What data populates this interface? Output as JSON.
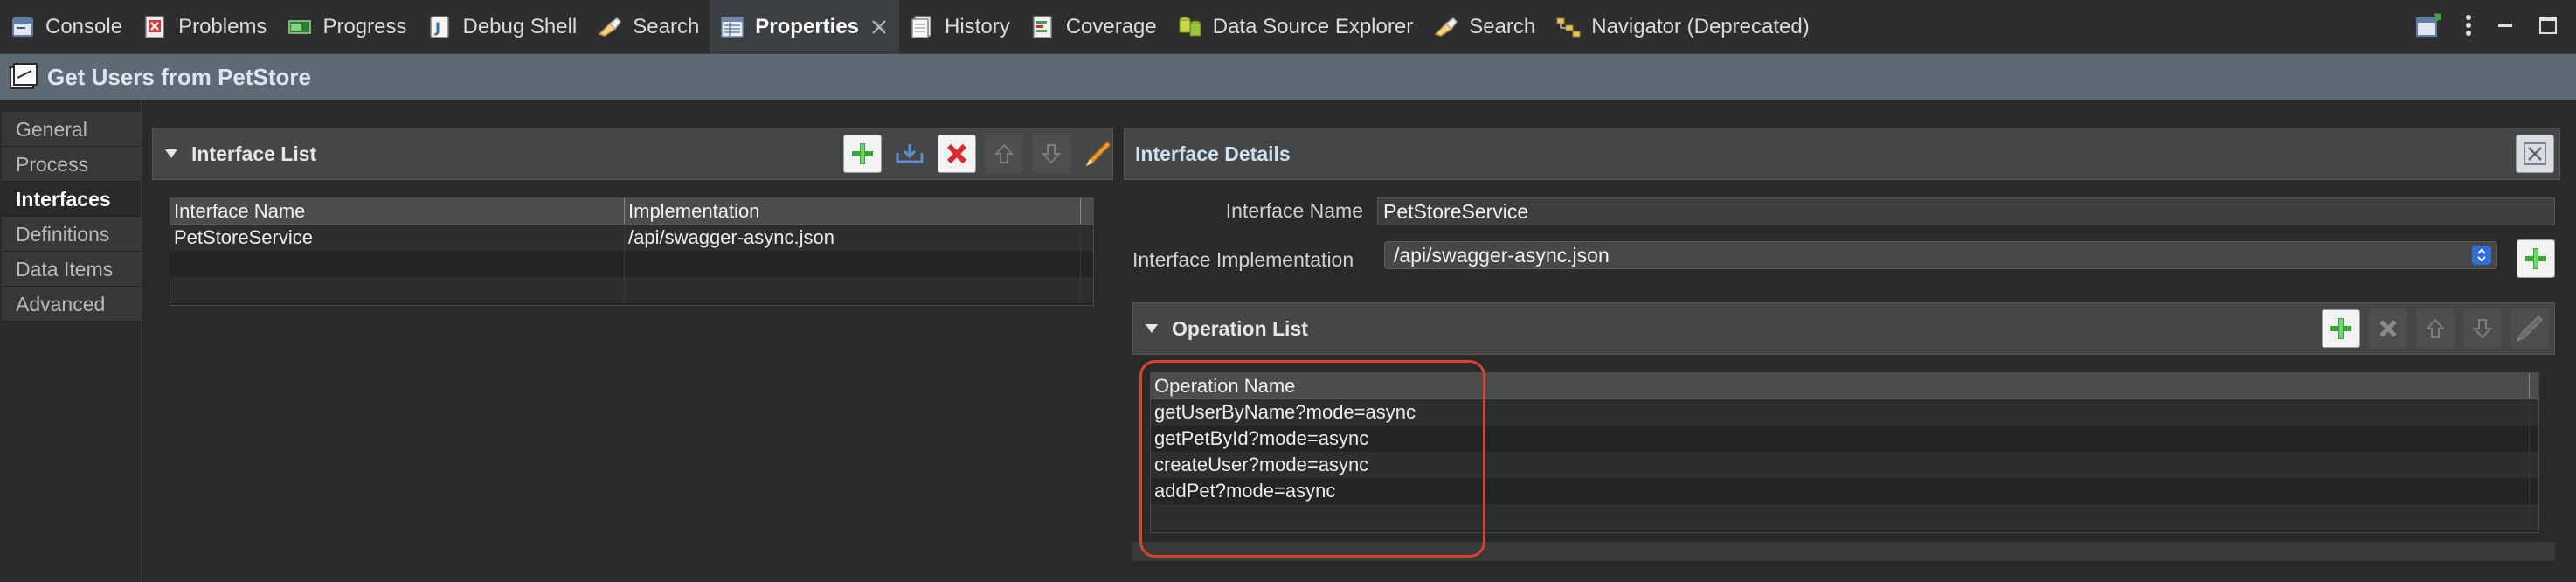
{
  "tabs": [
    {
      "label": "Console",
      "icon": "console-icon"
    },
    {
      "label": "Problems",
      "icon": "problems-icon"
    },
    {
      "label": "Progress",
      "icon": "progress-icon"
    },
    {
      "label": "Debug Shell",
      "icon": "debug-shell-icon"
    },
    {
      "label": "Search",
      "icon": "search-icon"
    },
    {
      "label": "Properties",
      "icon": "properties-icon",
      "active": true
    },
    {
      "label": "History",
      "icon": "history-icon"
    },
    {
      "label": "Coverage",
      "icon": "coverage-icon"
    },
    {
      "label": "Data Source Explorer",
      "icon": "data-source-explorer-icon"
    },
    {
      "label": "Search",
      "icon": "search-icon"
    },
    {
      "label": "Navigator (Deprecated)",
      "icon": "navigator-icon"
    }
  ],
  "editor": {
    "title": "Get Users from PetStore"
  },
  "nav": {
    "items": [
      {
        "label": "General"
      },
      {
        "label": "Process"
      },
      {
        "label": "Interfaces",
        "active": true
      },
      {
        "label": "Definitions"
      },
      {
        "label": "Data Items"
      },
      {
        "label": "Advanced"
      }
    ]
  },
  "interface_list": {
    "title": "Interface List",
    "columns": [
      "Interface Name",
      "Implementation"
    ],
    "rows": [
      [
        "PetStoreService",
        "/api/swagger-async.json"
      ]
    ]
  },
  "interface_details": {
    "title": "Interface Details",
    "name_label": "Interface Name",
    "name_value": "PetStoreService",
    "impl_label": "Interface Implementation",
    "impl_value": "/api/swagger-async.json"
  },
  "operation_list": {
    "title": "Operation List",
    "columns": [
      "Operation Name"
    ],
    "rows": [
      "getUserByName?mode=async",
      "getPetById?mode=async",
      "createUser?mode=async",
      "addPet?mode=async"
    ]
  },
  "colors": {
    "highlight": "#d9432e",
    "title_bar": "#5f6a76",
    "add_green": "#3aa53a",
    "delete_red": "#d62c2c"
  }
}
